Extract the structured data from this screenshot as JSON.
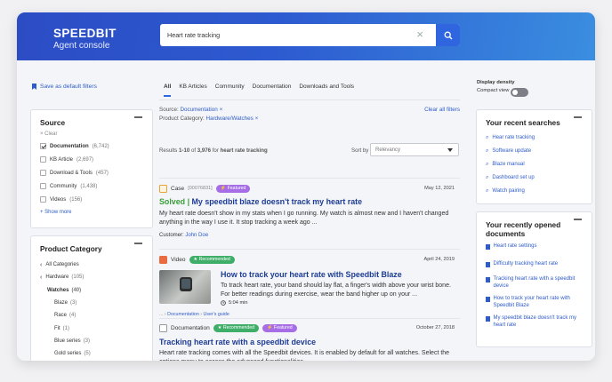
{
  "header": {
    "brand_name": "SPEEDBIT",
    "brand_sub": "Agent console",
    "search_value": "Heart rate tracking"
  },
  "left": {
    "save_filters": "Save as default filters",
    "source": {
      "title": "Source",
      "clear": "× Clear",
      "items": [
        {
          "label": "Documentation",
          "count": "(6,742)",
          "checked": true
        },
        {
          "label": "KB Article",
          "count": "(2,697)",
          "checked": false
        },
        {
          "label": "Download & Tools",
          "count": "(457)",
          "checked": false
        },
        {
          "label": "Community",
          "count": "(1,438)",
          "checked": false
        },
        {
          "label": "Videos",
          "count": "(156)",
          "checked": false
        }
      ],
      "show_more": "+ Show more"
    },
    "category": {
      "title": "Product Category",
      "all": "All Categories",
      "hardware": "Hardware",
      "hardware_count": "(105)",
      "watches": "Watches",
      "watches_count": "(40)",
      "sub": [
        {
          "label": "Blaze",
          "count": "(3)"
        },
        {
          "label": "Race",
          "count": "(4)"
        },
        {
          "label": "Fit",
          "count": "(1)"
        },
        {
          "label": "Blue series",
          "count": "(3)"
        },
        {
          "label": "Gold series",
          "count": "(5)"
        }
      ]
    }
  },
  "center": {
    "tabs": [
      "All",
      "KB Articles",
      "Community",
      "Documentation",
      "Downloads and Tools"
    ],
    "filters": {
      "source_label": "Source:",
      "source_value": "Documentation",
      "cat_label": "Product Category:",
      "cat_value": "Hardware/Watches",
      "clear_all": "Clear all filters"
    },
    "results": {
      "prefix": "Results",
      "range": "1-10",
      "of": "of",
      "total": "3,976",
      "for": "for",
      "query": "heart rate tracking",
      "sort_label": "Sort by",
      "sort_value": "Relevancy"
    },
    "items": [
      {
        "type": "Case",
        "id": "[00076831]",
        "badge": "Featured",
        "date": "May 12, 2021",
        "solved": "Solved |",
        "title": "My speedbit blaze doesn't track my heart rate",
        "desc": "My heart rate doesn't show in my stats when I go running. My watch is almost new and I haven't changed anything in the way I use it. It stop tracking a week ago ...",
        "cust_label": "Customer:",
        "cust_name": "John Doe"
      },
      {
        "type": "Video",
        "badge": "Recommended",
        "date": "April 24, 2019",
        "title": "How to track your heart rate with Speedbit Blaze",
        "desc": "To track heart rate, your band should lay flat, a finger's width above your wrist bone. For better readings during exercise, wear the band higher up on your ...",
        "duration": "5:04 min",
        "crumb1": "...",
        "crumb2": "Documentation",
        "crumb3": "User's guide"
      },
      {
        "type": "Documentation",
        "badge1": "Recommended",
        "badge2": "Featured",
        "date": "October 27, 2018",
        "title": "Tracking heart rate with a speedbit device",
        "desc": "Heart rate tracking comes with all the Speedbit devices. It is enabled by default for all watches. Select the options menu to access the advanced functionalities"
      }
    ]
  },
  "right": {
    "density_label": "Display density",
    "compact_label": "Compact view",
    "recent_searches": {
      "title": "Your recent searches",
      "items": [
        "Hear rate tracking",
        "Software update",
        "Blaze manual",
        "Dashboard set up",
        "Watch pairing"
      ]
    },
    "recent_docs": {
      "title": "Your recently opened documents",
      "items": [
        "Heart rate settings",
        "Difficulty tracking heart rate",
        "Tracking heart rate with a speedbit device",
        "How to track your heart rate with Speedbit Blaze",
        "My speedbit blaze doesn't track my heart rate"
      ]
    }
  },
  "colors": {
    "accent": "#2f66e0",
    "link": "#2e5cc8",
    "featured": "#a66de6",
    "recommended": "#3fae69",
    "solved": "#3a9e3a"
  }
}
